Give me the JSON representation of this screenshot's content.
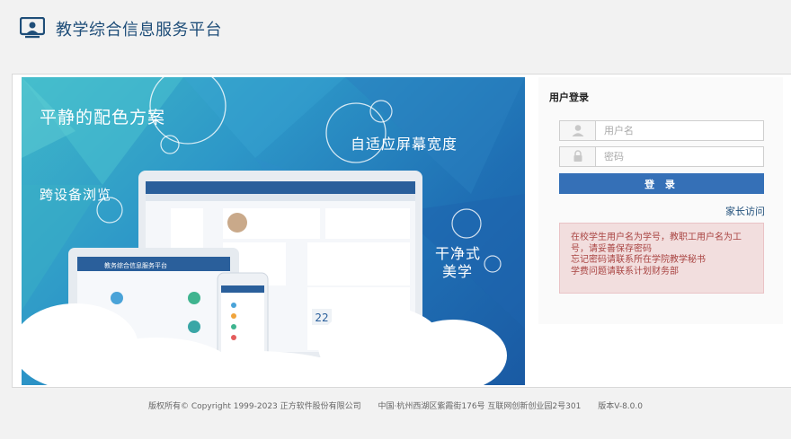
{
  "header": {
    "title": "教学综合信息服务平台"
  },
  "banner": {
    "slogan1": "平静的配色方案",
    "slogan2": "自适应屏幕宽度",
    "slogan3": "跨设备浏览",
    "slogan4a": "干净式",
    "slogan4b": "美学",
    "device_title": "教务综合信息服务平台",
    "calendar_day": "22"
  },
  "login": {
    "title": "用户登录",
    "username_placeholder": "用户名",
    "password_placeholder": "密码",
    "submit_label": "登 录",
    "parent_link": "家长访问",
    "notice_lines": [
      "在校学生用户名为学号，教职工用户名为工",
      "号，请妥善保存密码",
      "忘记密码请联系所在学院教学秘书",
      "学费问题请联系计划财务部"
    ]
  },
  "footer": {
    "copyright": "版权所有© Copyright 1999-2023 正方软件股份有限公司",
    "address": "中国·杭州西湖区紫霞街176号 互联网创新创业园2号301",
    "version": "版本V-8.0.0"
  },
  "colors": {
    "brand": "#1f4e79",
    "button": "#3570b7",
    "notice_bg": "#f2dede",
    "notice_text": "#a94442"
  }
}
